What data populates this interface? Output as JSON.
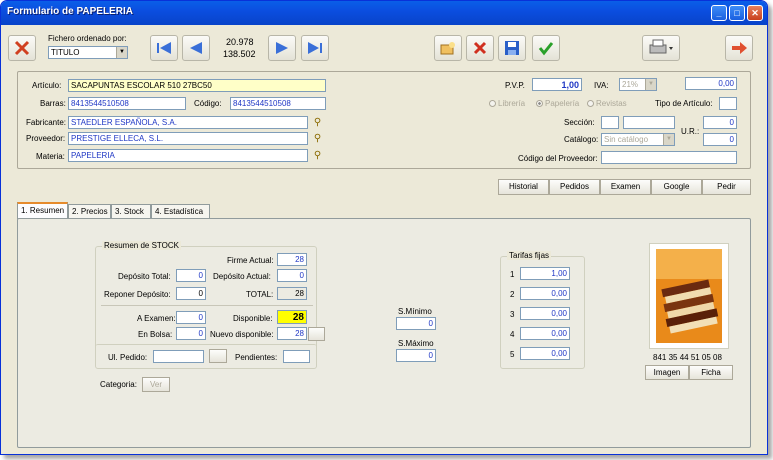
{
  "window": {
    "title": "Formulario de PAPELERIA"
  },
  "toolbar": {
    "sort_label": "Fichero ordenado por:",
    "sort_value": "TITULO",
    "record_index": "20.978",
    "record_total": "138.502"
  },
  "article": {
    "articulo_label": "Artículo:",
    "articulo": "SACAPUNTAS ESCOLAR 510 27BC50",
    "barras_label": "Barras:",
    "barras": "8413544510508",
    "codigo_label": "Código:",
    "codigo": "8413544510508",
    "fabricante_label": "Fabricante:",
    "fabricante": "STAEDLER ESPAÑOLA, S.A.",
    "proveedor_label": "Proveedor:",
    "proveedor": "PRESTIGE ELLECA, S.L.",
    "materia_label": "Materia:",
    "materia": "PAPELERIA",
    "pvp_label": "P.V.P.",
    "pvp": "1,00",
    "iva_label": "IVA:",
    "iva": "21%",
    "iva_amount": "0,00",
    "radio_libreria": "Librería",
    "radio_papeleria": "Papelería",
    "radio_revistas": "Revistas",
    "tipo_label": "Tipo de Artículo:",
    "seccion_label": "Sección:",
    "catalogo_label": "Catálogo:",
    "catalogo": "Sin catálogo",
    "ur_label": "U.R.:",
    "ur1": "0",
    "ur2": "0",
    "codprov_label": "Código del Proveedor:"
  },
  "actions": [
    "Historial",
    "Pedidos",
    "Examen",
    "Google",
    "Pedir"
  ],
  "tabs": [
    "1. Resumen",
    "2. Precios",
    "3. Stock",
    "4. Estadística"
  ],
  "stock": {
    "legend": "Resumen de STOCK",
    "firme_label": "Firme Actual:",
    "firme": "28",
    "deptotal_label": "Depósito Total:",
    "deptotal": "0",
    "depactual_label": "Depósito Actual:",
    "depactual": "0",
    "reponer_label": "Reponer Depósito:",
    "reponer": "0",
    "total_label": "TOTAL:",
    "total": "28",
    "aexamen_label": "A Examen:",
    "aexamen": "0",
    "disponible_label": "Disponible:",
    "disponible": "28",
    "enbolsa_label": "En Bolsa:",
    "enbolsa": "0",
    "nuevodisp_label": "Nuevo disponible:",
    "nuevodisp": "28",
    "ulpedido_label": "Ul. Pedido:",
    "pendientes_label": "Pendientes:"
  },
  "smin_label": "S.Mínimo",
  "smin": "0",
  "smax_label": "S.Máximo",
  "smax": "0",
  "categoria_label": "Categoria:",
  "ver_label": "Ver",
  "tarifas": {
    "legend": "Tarifas fijas",
    "rows": [
      {
        "n": "1",
        "v": "1,00"
      },
      {
        "n": "2",
        "v": "0,00"
      },
      {
        "n": "3",
        "v": "0,00"
      },
      {
        "n": "4",
        "v": "0,00"
      },
      {
        "n": "5",
        "v": "0,00"
      }
    ]
  },
  "image_caption": "841 35 44 51 05 08",
  "image_btn": "Imagen",
  "ficha_btn": "Ficha",
  "colors": {
    "accent": "#1f37c5",
    "highlight": "#ffff00",
    "title": "#0a5fe8"
  }
}
